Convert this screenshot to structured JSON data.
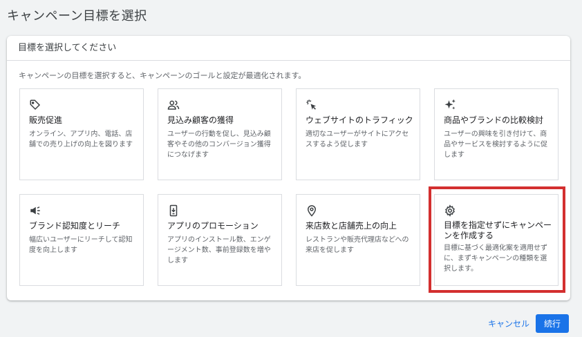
{
  "page": {
    "title": "キャンペーン目標を選択"
  },
  "panel": {
    "header": "目標を選択してください",
    "description": "キャンペーンの目標を選択すると、キャンペーンのゴールと設定が最適化されます。"
  },
  "cards": [
    {
      "icon": "tag-icon",
      "title": "販売促進",
      "description": "オンライン、アプリ内、電話、店舗での売り上げの向上を図ります"
    },
    {
      "icon": "people-icon",
      "title": "見込み顧客の獲得",
      "description": "ユーザーの行動を促し、見込み顧客やその他のコンバージョン獲得につなげます"
    },
    {
      "icon": "cursor-click-icon",
      "title": "ウェブサイトのトラフィック",
      "description": "適切なユーザーがサイトにアクセスするよう促します"
    },
    {
      "icon": "sparkle-icon",
      "title": "商品やブランドの比較検討",
      "description": "ユーザーの興味を引き付けて、商品やサービスを検討するように促します"
    },
    {
      "icon": "megaphone-icon",
      "title": "ブランド認知度とリーチ",
      "description": "幅広いユーザーにリーチして認知度を向上します"
    },
    {
      "icon": "phone-download-icon",
      "title": "アプリのプロモーション",
      "description": "アプリのインストール数、エンゲージメント数、事前登録数を増やします"
    },
    {
      "icon": "location-pin-icon",
      "title": "来店数と店舗売上の向上",
      "description": "レストランや販売代理店などへの来店を促します"
    },
    {
      "icon": "gear-icon",
      "title": "目標を指定せずにキャンペーンを作成する",
      "description": "目標に基づく最適化案を適用せずに、まずキャンペーンの種類を選択します。"
    }
  ],
  "highlight_color": "#d32f2f",
  "accent_color": "#1a73e8",
  "footer": {
    "cancel_label": "キャンセル",
    "continue_label": "続行"
  }
}
